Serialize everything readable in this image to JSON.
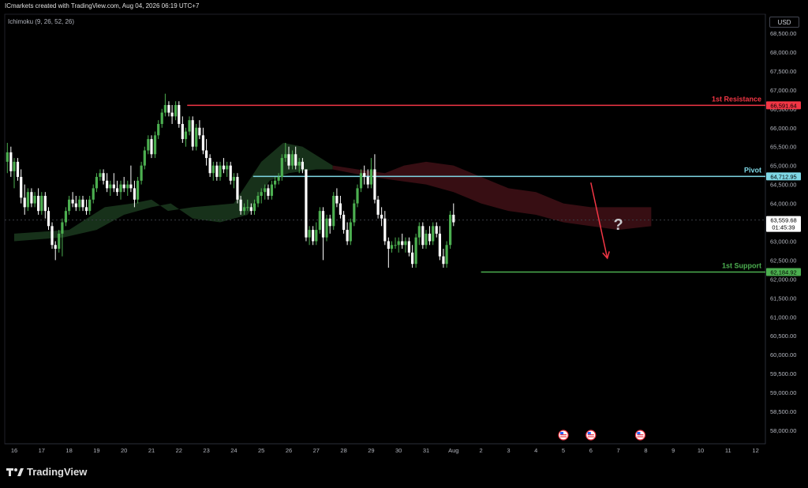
{
  "header": {
    "text": "ICmarkets created with TradingView.com, Aug 04, 2026 06:19 UTC+7"
  },
  "indicator": {
    "label": "Ichimoku (9, 26, 52, 26)"
  },
  "currency": {
    "label": "USD"
  },
  "footer": {
    "logo_text": "TradingView"
  },
  "colors": {
    "up": "#4caf50",
    "down": "#ffffff",
    "resistance": "#f23645",
    "pivot": "#7fd8e6",
    "support": "#4caf50",
    "arrow": "#f23645",
    "cloud_bull": "#1b3a1f",
    "cloud_bear": "#3d1015"
  },
  "icons": {
    "event_icon": "us-flag-icon",
    "question_icon": "question-mark-icon"
  },
  "chart_data": {
    "type": "candlestick",
    "price_axis": {
      "range": [
        57800,
        68700
      ],
      "ticks": [
        68500,
        68000,
        67500,
        67000,
        66500,
        66000,
        65500,
        65000,
        64500,
        64000,
        63500,
        63000,
        62500,
        62000,
        61500,
        61000,
        60500,
        60000,
        59500,
        59000,
        58500,
        58000
      ],
      "tick_labels": [
        "68,500.00",
        "68,000.00",
        "67,500.00",
        "67,000.00",
        "66,500.00",
        "66,000.00",
        "65,500.00",
        "65,000.00",
        "64,500.00",
        "64,000.00",
        "63,500.00",
        "63,000.00",
        "62,500.00",
        "62,000.00",
        "61,500.00",
        "61,000.00",
        "60,500.00",
        "60,000.00",
        "59,500.00",
        "59,000.00",
        "58,500.00",
        "58,000.00"
      ]
    },
    "time_axis": {
      "labels": [
        "16",
        "17",
        "18",
        "19",
        "20",
        "21",
        "22",
        "23",
        "24",
        "25",
        "26",
        "27",
        "28",
        "29",
        "30",
        "31",
        "Aug",
        "2",
        "3",
        "4",
        "5",
        "6",
        "7",
        "8",
        "9",
        "10",
        "11",
        "12"
      ],
      "days": [
        16,
        17,
        18,
        19,
        20,
        21,
        22,
        23,
        24,
        25,
        26,
        27,
        28,
        29,
        30,
        31,
        32,
        33,
        34,
        35,
        36,
        37,
        38,
        39,
        40,
        41,
        42,
        43
      ]
    },
    "levels": [
      {
        "name": "1st Resistance",
        "value": 66591.64,
        "label": "66,591.64",
        "from_day": 22.3,
        "color_key": "resistance"
      },
      {
        "name": "Pivot",
        "value": 64712.95,
        "label": "64,712.95",
        "from_day": 24.7,
        "color_key": "pivot"
      },
      {
        "name": "1st Support",
        "value": 62184.92,
        "label": "62,184.92",
        "from_day": 33.0,
        "color_key": "support"
      }
    ],
    "current_price": {
      "value": 63559.68,
      "label": "63,559.68",
      "countdown": "01:45:39"
    },
    "candles": [
      {
        "d": 15.75,
        "o": 65100,
        "h": 65600,
        "l": 64800,
        "c": 65350
      },
      {
        "d": 15.88,
        "o": 65350,
        "h": 65500,
        "l": 64700,
        "c": 64850
      },
      {
        "d": 16.0,
        "o": 64850,
        "h": 65200,
        "l": 64400,
        "c": 65100
      },
      {
        "d": 16.13,
        "o": 65100,
        "h": 65200,
        "l": 64600,
        "c": 64700
      },
      {
        "d": 16.25,
        "o": 64700,
        "h": 64900,
        "l": 64000,
        "c": 64150
      },
      {
        "d": 16.38,
        "o": 64150,
        "h": 64500,
        "l": 63700,
        "c": 63900
      },
      {
        "d": 16.5,
        "o": 63900,
        "h": 64400,
        "l": 63800,
        "c": 64300
      },
      {
        "d": 16.63,
        "o": 64300,
        "h": 64400,
        "l": 63900,
        "c": 64000
      },
      {
        "d": 16.75,
        "o": 64000,
        "h": 64300,
        "l": 63900,
        "c": 64200
      },
      {
        "d": 16.88,
        "o": 64200,
        "h": 64400,
        "l": 63700,
        "c": 63800
      },
      {
        "d": 17.0,
        "o": 63800,
        "h": 64300,
        "l": 63700,
        "c": 64200
      },
      {
        "d": 17.13,
        "o": 64200,
        "h": 64300,
        "l": 63600,
        "c": 63800
      },
      {
        "d": 17.25,
        "o": 63800,
        "h": 63900,
        "l": 63300,
        "c": 63400
      },
      {
        "d": 17.38,
        "o": 63400,
        "h": 63500,
        "l": 62800,
        "c": 62900
      },
      {
        "d": 17.5,
        "o": 62900,
        "h": 63000,
        "l": 62500,
        "c": 62800
      },
      {
        "d": 17.63,
        "o": 62800,
        "h": 63300,
        "l": 62700,
        "c": 63200
      },
      {
        "d": 17.75,
        "o": 63200,
        "h": 63600,
        "l": 62600,
        "c": 63500
      },
      {
        "d": 17.88,
        "o": 63500,
        "h": 63900,
        "l": 63400,
        "c": 63800
      },
      {
        "d": 18.0,
        "o": 63800,
        "h": 64200,
        "l": 63700,
        "c": 64100
      },
      {
        "d": 18.13,
        "o": 64100,
        "h": 64300,
        "l": 63900,
        "c": 64000
      },
      {
        "d": 18.25,
        "o": 64000,
        "h": 64200,
        "l": 63800,
        "c": 63900
      },
      {
        "d": 18.38,
        "o": 63900,
        "h": 64200,
        "l": 63800,
        "c": 64100
      },
      {
        "d": 18.5,
        "o": 64100,
        "h": 64200,
        "l": 63800,
        "c": 63900
      },
      {
        "d": 18.63,
        "o": 63900,
        "h": 64100,
        "l": 63700,
        "c": 63800
      },
      {
        "d": 18.75,
        "o": 63800,
        "h": 64200,
        "l": 63700,
        "c": 64100
      },
      {
        "d": 18.88,
        "o": 64100,
        "h": 64500,
        "l": 64000,
        "c": 64400
      },
      {
        "d": 19.0,
        "o": 64400,
        "h": 64800,
        "l": 64300,
        "c": 64700
      },
      {
        "d": 19.13,
        "o": 64700,
        "h": 64900,
        "l": 64600,
        "c": 64800
      },
      {
        "d": 19.25,
        "o": 64800,
        "h": 64900,
        "l": 64500,
        "c": 64600
      },
      {
        "d": 19.38,
        "o": 64600,
        "h": 64800,
        "l": 64300,
        "c": 64400
      },
      {
        "d": 19.5,
        "o": 64400,
        "h": 64600,
        "l": 64200,
        "c": 64500
      },
      {
        "d": 19.63,
        "o": 64500,
        "h": 64800,
        "l": 64300,
        "c": 64400
      },
      {
        "d": 19.75,
        "o": 64400,
        "h": 64600,
        "l": 64200,
        "c": 64300
      },
      {
        "d": 19.88,
        "o": 64300,
        "h": 64600,
        "l": 64100,
        "c": 64500
      },
      {
        "d": 20.0,
        "o": 64500,
        "h": 64700,
        "l": 64300,
        "c": 64400
      },
      {
        "d": 20.13,
        "o": 64400,
        "h": 64600,
        "l": 64200,
        "c": 64500
      },
      {
        "d": 20.25,
        "o": 64500,
        "h": 65000,
        "l": 64300,
        "c": 64400
      },
      {
        "d": 20.38,
        "o": 64400,
        "h": 64600,
        "l": 63900,
        "c": 64100
      },
      {
        "d": 20.5,
        "o": 64100,
        "h": 64700,
        "l": 64000,
        "c": 64600
      },
      {
        "d": 20.63,
        "o": 64600,
        "h": 65100,
        "l": 64500,
        "c": 65000
      },
      {
        "d": 20.75,
        "o": 65000,
        "h": 65500,
        "l": 64900,
        "c": 65400
      },
      {
        "d": 20.88,
        "o": 65400,
        "h": 65800,
        "l": 65300,
        "c": 65700
      },
      {
        "d": 21.0,
        "o": 65700,
        "h": 65800,
        "l": 65200,
        "c": 65300
      },
      {
        "d": 21.13,
        "o": 65300,
        "h": 65900,
        "l": 65200,
        "c": 65800
      },
      {
        "d": 21.25,
        "o": 65800,
        "h": 66200,
        "l": 65700,
        "c": 66100
      },
      {
        "d": 21.38,
        "o": 66100,
        "h": 66500,
        "l": 66000,
        "c": 66400
      },
      {
        "d": 21.5,
        "o": 66400,
        "h": 66900,
        "l": 66300,
        "c": 66600
      },
      {
        "d": 21.63,
        "o": 66600,
        "h": 66700,
        "l": 66300,
        "c": 66400
      },
      {
        "d": 21.75,
        "o": 66400,
        "h": 66600,
        "l": 66100,
        "c": 66300
      },
      {
        "d": 21.88,
        "o": 66300,
        "h": 66700,
        "l": 66200,
        "c": 66600
      },
      {
        "d": 22.0,
        "o": 66600,
        "h": 66700,
        "l": 66000,
        "c": 66100
      },
      {
        "d": 22.13,
        "o": 66100,
        "h": 66300,
        "l": 65600,
        "c": 65700
      },
      {
        "d": 22.25,
        "o": 65700,
        "h": 66000,
        "l": 65500,
        "c": 65900
      },
      {
        "d": 22.38,
        "o": 65900,
        "h": 66300,
        "l": 65800,
        "c": 66200
      },
      {
        "d": 22.5,
        "o": 66200,
        "h": 66300,
        "l": 65400,
        "c": 65500
      },
      {
        "d": 22.63,
        "o": 65500,
        "h": 66100,
        "l": 65400,
        "c": 66000
      },
      {
        "d": 22.75,
        "o": 66000,
        "h": 66200,
        "l": 65700,
        "c": 65800
      },
      {
        "d": 22.88,
        "o": 65800,
        "h": 66000,
        "l": 65300,
        "c": 65400
      },
      {
        "d": 23.0,
        "o": 65400,
        "h": 65700,
        "l": 65000,
        "c": 65200
      },
      {
        "d": 23.13,
        "o": 65200,
        "h": 65300,
        "l": 64700,
        "c": 64800
      },
      {
        "d": 23.25,
        "o": 64800,
        "h": 65100,
        "l": 64600,
        "c": 65000
      },
      {
        "d": 23.38,
        "o": 65000,
        "h": 65100,
        "l": 64600,
        "c": 64700
      },
      {
        "d": 23.5,
        "o": 64700,
        "h": 65100,
        "l": 64600,
        "c": 65000
      },
      {
        "d": 23.63,
        "o": 65000,
        "h": 65200,
        "l": 64800,
        "c": 64900
      },
      {
        "d": 23.75,
        "o": 64900,
        "h": 65100,
        "l": 64700,
        "c": 65000
      },
      {
        "d": 23.88,
        "o": 65000,
        "h": 65100,
        "l": 64500,
        "c": 64600
      },
      {
        "d": 24.0,
        "o": 64600,
        "h": 64800,
        "l": 64400,
        "c": 64700
      },
      {
        "d": 24.13,
        "o": 64700,
        "h": 64800,
        "l": 64000,
        "c": 64100
      },
      {
        "d": 24.25,
        "o": 64100,
        "h": 64200,
        "l": 63700,
        "c": 63800
      },
      {
        "d": 24.38,
        "o": 63800,
        "h": 64000,
        "l": 63700,
        "c": 63900
      },
      {
        "d": 24.5,
        "o": 63900,
        "h": 64100,
        "l": 63800,
        "c": 63900
      },
      {
        "d": 24.63,
        "o": 63900,
        "h": 64000,
        "l": 63700,
        "c": 63800
      },
      {
        "d": 24.75,
        "o": 63800,
        "h": 64100,
        "l": 63700,
        "c": 64000
      },
      {
        "d": 24.88,
        "o": 64000,
        "h": 64300,
        "l": 63900,
        "c": 64200
      },
      {
        "d": 25.0,
        "o": 64200,
        "h": 64400,
        "l": 64000,
        "c": 64300
      },
      {
        "d": 25.13,
        "o": 64300,
        "h": 64500,
        "l": 64100,
        "c": 64400
      },
      {
        "d": 25.25,
        "o": 64400,
        "h": 64500,
        "l": 64100,
        "c": 64200
      },
      {
        "d": 25.38,
        "o": 64200,
        "h": 64600,
        "l": 64100,
        "c": 64500
      },
      {
        "d": 25.5,
        "o": 64500,
        "h": 64700,
        "l": 64400,
        "c": 64600
      },
      {
        "d": 25.63,
        "o": 64600,
        "h": 64800,
        "l": 64500,
        "c": 64700
      },
      {
        "d": 25.75,
        "o": 64700,
        "h": 65300,
        "l": 64600,
        "c": 65200
      },
      {
        "d": 25.88,
        "o": 65200,
        "h": 65600,
        "l": 65100,
        "c": 65300
      },
      {
        "d": 26.0,
        "o": 65300,
        "h": 65500,
        "l": 64900,
        "c": 65000
      },
      {
        "d": 26.13,
        "o": 65000,
        "h": 65400,
        "l": 64900,
        "c": 65300
      },
      {
        "d": 26.25,
        "o": 65300,
        "h": 65500,
        "l": 64900,
        "c": 65000
      },
      {
        "d": 26.38,
        "o": 65000,
        "h": 65200,
        "l": 64800,
        "c": 65100
      },
      {
        "d": 26.5,
        "o": 65100,
        "h": 65200,
        "l": 64800,
        "c": 64900
      },
      {
        "d": 26.63,
        "o": 64900,
        "h": 64900,
        "l": 63000,
        "c": 63100
      },
      {
        "d": 26.75,
        "o": 63100,
        "h": 63400,
        "l": 62900,
        "c": 63300
      },
      {
        "d": 26.88,
        "o": 63300,
        "h": 63400,
        "l": 62900,
        "c": 63000
      },
      {
        "d": 27.0,
        "o": 63000,
        "h": 63500,
        "l": 62900,
        "c": 63300
      },
      {
        "d": 27.13,
        "o": 63300,
        "h": 63900,
        "l": 63200,
        "c": 63800
      },
      {
        "d": 27.25,
        "o": 63800,
        "h": 63900,
        "l": 62500,
        "c": 63100
      },
      {
        "d": 27.38,
        "o": 63100,
        "h": 63700,
        "l": 63000,
        "c": 63600
      },
      {
        "d": 27.5,
        "o": 63600,
        "h": 63700,
        "l": 63200,
        "c": 63400
      },
      {
        "d": 27.63,
        "o": 63400,
        "h": 64300,
        "l": 63300,
        "c": 64200
      },
      {
        "d": 27.75,
        "o": 64200,
        "h": 64400,
        "l": 63900,
        "c": 64000
      },
      {
        "d": 27.88,
        "o": 64000,
        "h": 64200,
        "l": 63600,
        "c": 63700
      },
      {
        "d": 28.0,
        "o": 63700,
        "h": 63800,
        "l": 63200,
        "c": 63300
      },
      {
        "d": 28.13,
        "o": 63300,
        "h": 63500,
        "l": 62900,
        "c": 63000
      },
      {
        "d": 28.25,
        "o": 63000,
        "h": 63600,
        "l": 62900,
        "c": 63500
      },
      {
        "d": 28.38,
        "o": 63500,
        "h": 64100,
        "l": 63400,
        "c": 64000
      },
      {
        "d": 28.5,
        "o": 64000,
        "h": 64500,
        "l": 63900,
        "c": 64400
      },
      {
        "d": 28.63,
        "o": 64400,
        "h": 64900,
        "l": 64300,
        "c": 64800
      },
      {
        "d": 28.75,
        "o": 64800,
        "h": 65000,
        "l": 64500,
        "c": 64700
      },
      {
        "d": 28.88,
        "o": 64700,
        "h": 64900,
        "l": 64400,
        "c": 64500
      },
      {
        "d": 29.0,
        "o": 64500,
        "h": 65200,
        "l": 64400,
        "c": 64900
      },
      {
        "d": 29.13,
        "o": 64900,
        "h": 65300,
        "l": 64000,
        "c": 64100
      },
      {
        "d": 29.25,
        "o": 64100,
        "h": 64200,
        "l": 63600,
        "c": 63700
      },
      {
        "d": 29.38,
        "o": 63700,
        "h": 63900,
        "l": 63400,
        "c": 63600
      },
      {
        "d": 29.5,
        "o": 63600,
        "h": 63800,
        "l": 62900,
        "c": 63000
      },
      {
        "d": 29.63,
        "o": 63000,
        "h": 63100,
        "l": 62300,
        "c": 62800
      },
      {
        "d": 29.75,
        "o": 62800,
        "h": 63000,
        "l": 62700,
        "c": 62900
      },
      {
        "d": 29.88,
        "o": 62900,
        "h": 63100,
        "l": 62800,
        "c": 62900
      },
      {
        "d": 30.0,
        "o": 62900,
        "h": 63100,
        "l": 62700,
        "c": 63000
      },
      {
        "d": 30.13,
        "o": 63000,
        "h": 63200,
        "l": 62800,
        "c": 62900
      },
      {
        "d": 30.25,
        "o": 62900,
        "h": 63100,
        "l": 62700,
        "c": 63000
      },
      {
        "d": 30.38,
        "o": 63000,
        "h": 63100,
        "l": 62600,
        "c": 62700
      },
      {
        "d": 30.5,
        "o": 62700,
        "h": 62900,
        "l": 62300,
        "c": 62400
      },
      {
        "d": 30.63,
        "o": 62400,
        "h": 63200,
        "l": 62300,
        "c": 63100
      },
      {
        "d": 30.75,
        "o": 63100,
        "h": 63500,
        "l": 62900,
        "c": 63400
      },
      {
        "d": 30.88,
        "o": 63400,
        "h": 63500,
        "l": 62800,
        "c": 62900
      },
      {
        "d": 31.0,
        "o": 62900,
        "h": 63300,
        "l": 62800,
        "c": 63200
      },
      {
        "d": 31.13,
        "o": 63200,
        "h": 63400,
        "l": 62900,
        "c": 63000
      },
      {
        "d": 31.25,
        "o": 63000,
        "h": 63500,
        "l": 62900,
        "c": 63400
      },
      {
        "d": 31.38,
        "o": 63400,
        "h": 63500,
        "l": 63100,
        "c": 63200
      },
      {
        "d": 31.5,
        "o": 63200,
        "h": 63400,
        "l": 62500,
        "c": 62600
      },
      {
        "d": 31.63,
        "o": 62600,
        "h": 62800,
        "l": 62300,
        "c": 62400
      },
      {
        "d": 31.75,
        "o": 62400,
        "h": 63000,
        "l": 62300,
        "c": 62900
      },
      {
        "d": 31.88,
        "o": 62900,
        "h": 63800,
        "l": 62800,
        "c": 63700
      },
      {
        "d": 32.0,
        "o": 63700,
        "h": 64000,
        "l": 63400,
        "c": 63500
      }
    ]
  }
}
